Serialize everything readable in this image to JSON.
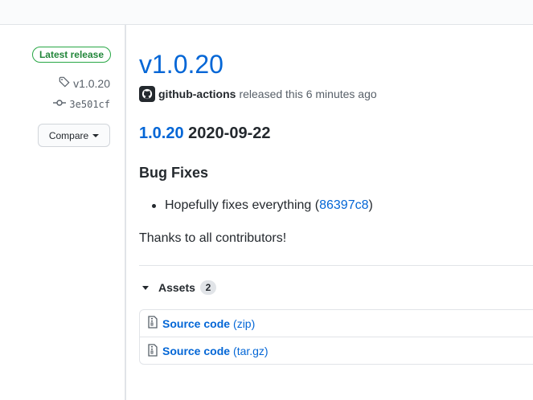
{
  "sidebar": {
    "badge": "Latest release",
    "tag": "v1.0.20",
    "commit": "3e501cf",
    "compare_label": "Compare"
  },
  "release": {
    "title": "v1.0.20",
    "author": "github-actions",
    "released_text": "released this 6 minutes ago",
    "version_link": "1.0.20",
    "date": "2020-09-22",
    "section_heading": "Bug Fixes",
    "bullet_text": "Hopefully fixes everything (",
    "bullet_commit": "86397c8",
    "bullet_close": ")",
    "thanks": "Thanks to all contributors!"
  },
  "assets": {
    "label": "Assets",
    "count": "2",
    "items": [
      {
        "name": "Source code",
        "format": "(zip)"
      },
      {
        "name": "Source code",
        "format": "(tar.gz)"
      }
    ]
  },
  "icons": {
    "tag": "tag-icon",
    "commit": "git-commit-icon",
    "avatar": "github-mark-icon",
    "file": "file-zip-icon"
  },
  "colors": {
    "link": "#0366d6",
    "badge": "#28a745",
    "text": "#24292e",
    "muted": "#586069"
  }
}
